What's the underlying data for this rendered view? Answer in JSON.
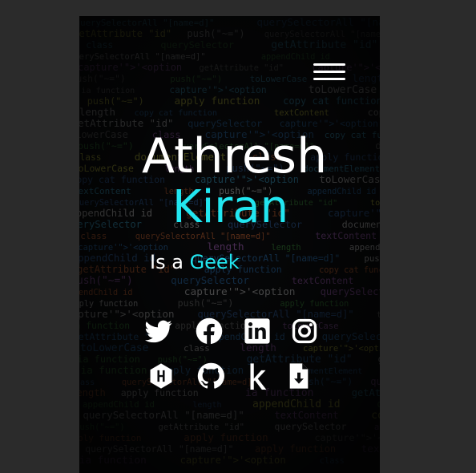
{
  "profile": {
    "first_name": "Athresh",
    "last_name": "Kiran",
    "tagline_prefix": "Is a",
    "tagline_word": "Geek"
  },
  "colors": {
    "page_background": "#2b2b2b",
    "accent": "#22e6f0",
    "text": "#ffffff"
  },
  "icons": [
    "twitter-icon",
    "facebook-icon",
    "linkedin-icon",
    "instagram-icon",
    "hackerrank-icon",
    "github-icon",
    "kaggle-icon",
    "resume-download-icon"
  ],
  "background_code_lines": [
    "copy  cat  function",
    "apply  function",
    "querySelector",
    "getAttribute \"id\"",
    "appendChild  id",
    "capture'\">'<option",
    "push(\"~=\")",
    "querySelectorAll \"[name=d]\"",
    "ia function",
    "documentElement",
    "toLowerCase",
    "textContent",
    "length",
    "class"
  ]
}
